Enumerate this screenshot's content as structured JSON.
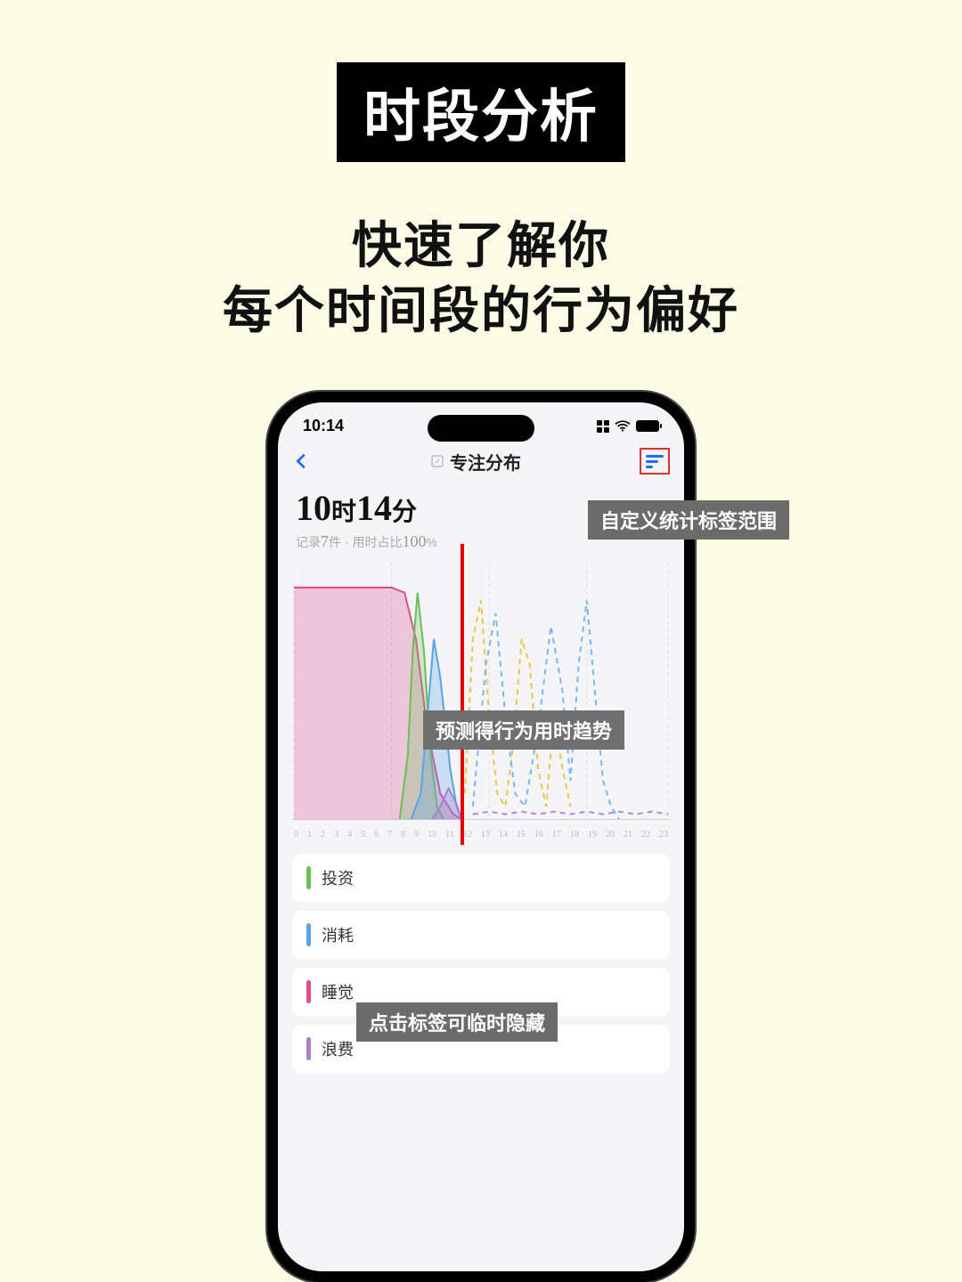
{
  "page": {
    "title_banner": "时段分析",
    "subtitle_line1": "快速了解你",
    "subtitle_line2": "每个时间段的行为偏好"
  },
  "status": {
    "time": "10:14"
  },
  "nav": {
    "title": "专注分布"
  },
  "stats": {
    "hours": "10",
    "hours_unit": "时",
    "minutes": "14",
    "minutes_unit": "分",
    "record_prefix": "记录",
    "record_count": "7",
    "record_suffix": "件",
    "dot": " · ",
    "usage_prefix": "用时占比",
    "usage_pct": "100",
    "usage_suffix": "%"
  },
  "legend": {
    "items": [
      {
        "label": "投资",
        "color": "#6bbf59"
      },
      {
        "label": "消耗",
        "color": "#5aa3e8"
      },
      {
        "label": "睡觉",
        "color": "#d94f8c"
      },
      {
        "label": "浪费",
        "color": "#a97fd1"
      }
    ]
  },
  "annotations": {
    "filter": "自定义统计标签范围",
    "predict": "预测得行为用时趋势",
    "hide": "点击标签可临时隐藏"
  },
  "chart_data": {
    "type": "area",
    "xlabel": "",
    "ylabel": "",
    "x_ticks": [
      "0",
      "1",
      "2",
      "3",
      "4",
      "5",
      "6",
      "7",
      "8",
      "9",
      "10",
      "11",
      "12",
      "13",
      "14",
      "15",
      "16",
      "17",
      "18",
      "19",
      "20",
      "21",
      "22",
      "23"
    ],
    "xlim": [
      0,
      23
    ],
    "ylim": [
      0,
      100
    ],
    "now_marker": 10.3,
    "grid_x": [
      0,
      6,
      12,
      18,
      23
    ],
    "series": [
      {
        "name": "睡觉",
        "color": "#d94f8c",
        "style": "solid",
        "x": [
          0,
          1,
          2,
          3,
          4,
          5,
          6,
          6.8,
          7.5,
          8.2,
          9,
          9.8,
          10.3
        ],
        "values": [
          90,
          90,
          90,
          90,
          90,
          90,
          90,
          88,
          70,
          35,
          10,
          2,
          0
        ]
      },
      {
        "name": "投资",
        "color": "#6bbf59",
        "style": "solid",
        "x": [
          6.5,
          7,
          7.3,
          7.6,
          8,
          8.4,
          8.8,
          9.2
        ],
        "values": [
          0,
          25,
          65,
          88,
          65,
          25,
          5,
          0
        ]
      },
      {
        "name": "消耗",
        "color": "#5aa3e8",
        "style": "solid",
        "x": [
          7.2,
          7.8,
          8.2,
          8.6,
          9,
          9.6,
          10,
          10.3
        ],
        "values": [
          0,
          10,
          40,
          70,
          55,
          20,
          5,
          0
        ]
      },
      {
        "name": "浪费",
        "color": "#a97fd1",
        "style": "solid",
        "x": [
          8.5,
          9,
          9.5,
          10,
          10.3
        ],
        "values": [
          0,
          5,
          12,
          6,
          0
        ]
      },
      {
        "name": "pred-yellow",
        "color": "#e7c74a",
        "style": "dashed",
        "x": [
          10.5,
          11,
          11.5,
          12,
          12.5,
          13,
          13.5,
          14,
          14.5,
          15,
          15.5,
          16,
          16.5,
          17
        ],
        "values": [
          10,
          70,
          85,
          40,
          10,
          5,
          30,
          70,
          60,
          20,
          5,
          40,
          20,
          5
        ]
      },
      {
        "name": "pred-blue",
        "color": "#7bb7ef",
        "style": "dashed",
        "x": [
          11,
          11.8,
          12.4,
          13,
          13.6,
          14.2,
          15,
          15.8,
          16.5,
          17,
          17.5,
          18,
          18.5,
          19,
          19.5,
          20
        ],
        "values": [
          5,
          60,
          80,
          40,
          10,
          5,
          35,
          75,
          50,
          15,
          60,
          85,
          50,
          15,
          5,
          0
        ]
      },
      {
        "name": "pred-purple",
        "color": "#b28bd9",
        "style": "dashed",
        "x": [
          11,
          12,
          13,
          14,
          15,
          16,
          17,
          18,
          19,
          20,
          21,
          22,
          23
        ],
        "values": [
          2,
          3,
          2,
          3,
          2,
          3,
          2,
          3,
          2,
          3,
          2,
          3,
          2
        ]
      }
    ]
  }
}
